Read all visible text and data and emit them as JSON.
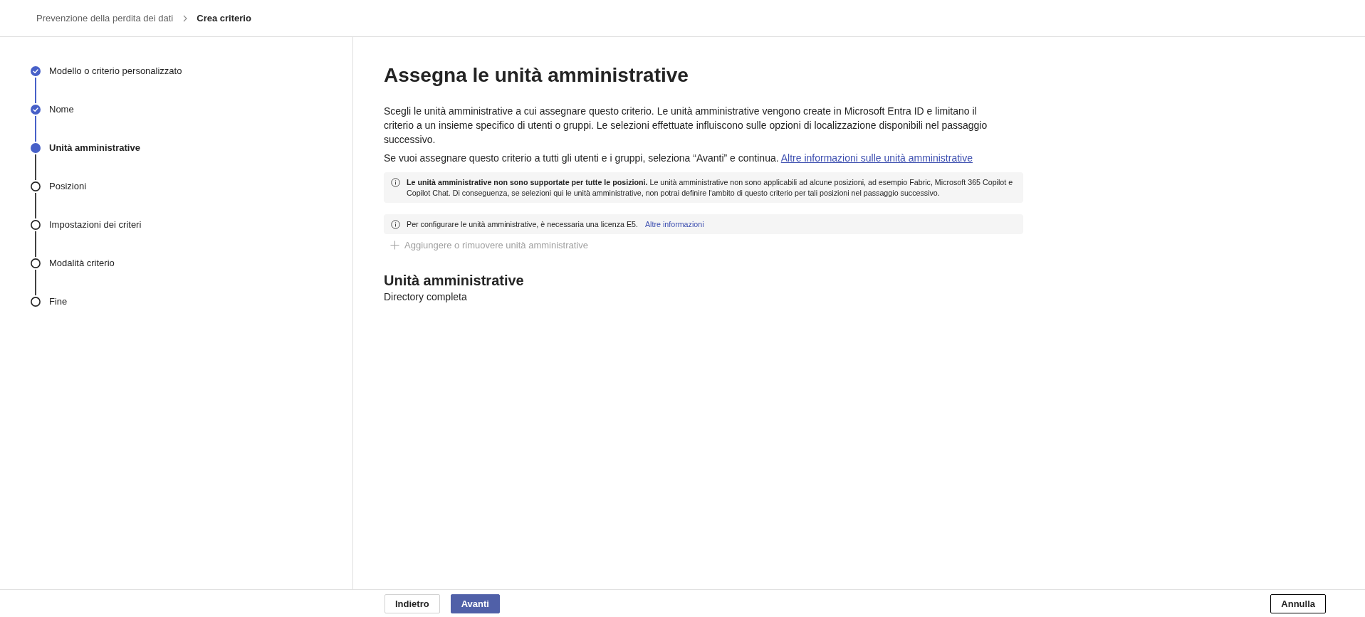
{
  "breadcrumb": [
    {
      "label": "Prevenzione della perdita dei dati",
      "current": false
    },
    {
      "label": "Crea criterio",
      "current": true
    }
  ],
  "steps": [
    {
      "label": "Modello o criterio personalizzato",
      "completed": true,
      "selected": false
    },
    {
      "label": "Nome",
      "completed": true,
      "selected": false
    },
    {
      "label": "Unità amministrative",
      "completed": false,
      "selected": true
    },
    {
      "label": "Posizioni",
      "completed": false,
      "selected": false
    },
    {
      "label": "Impostazioni dei criteri",
      "completed": false,
      "selected": false
    },
    {
      "label": "Modalità criterio",
      "completed": false,
      "selected": false
    },
    {
      "label": "Fine",
      "completed": false,
      "selected": false
    }
  ],
  "page": {
    "title": "Assegna le unità amministrative",
    "description": "Scegli le unità amministrative a cui assegnare questo criterio. Le unità amministrative vengono create in Microsoft Entra ID e limitano il criterio a un insieme specifico di utenti o gruppi. Le selezioni effettuate influiscono sulle opzioni di localizzazione disponibili nel passaggio successivo.",
    "note": "Se vuoi assegnare questo criterio a tutti gli utenti e i gruppi, seleziona “Avanti” e continua.",
    "note_link": "Altre informazioni sulle unità amministrative"
  },
  "notices": [
    {
      "text": "**Le unità amministrative non sono supportate per tutte le posizioni.** Le unità amministrative non sono applicabili ad alcune posizioni, ad esempio Fabric, Microsoft 365 Copilot e Copilot Chat. Di conseguenza, se selezioni qui le unità amministrative, non potrai definire l'ambito di questo criterio per tali posizioni nel passaggio successivo."
    },
    {
      "text": "Per configurare le unità amministrative, è necessaria una licenza E5.",
      "link": "Altre informazioni"
    }
  ],
  "add_button": {
    "label": "Aggiungere o rimuovere unità amministrative",
    "disabled": true
  },
  "section": {
    "title": "Unità amministrative",
    "value": "Directory completa"
  },
  "footer": {
    "navigation": [
      {
        "label": "Indietro",
        "kind": "secondary"
      },
      {
        "label": "Avanti",
        "kind": "primary"
      }
    ],
    "cancel": {
      "label": "Annulla",
      "focused": true
    }
  }
}
